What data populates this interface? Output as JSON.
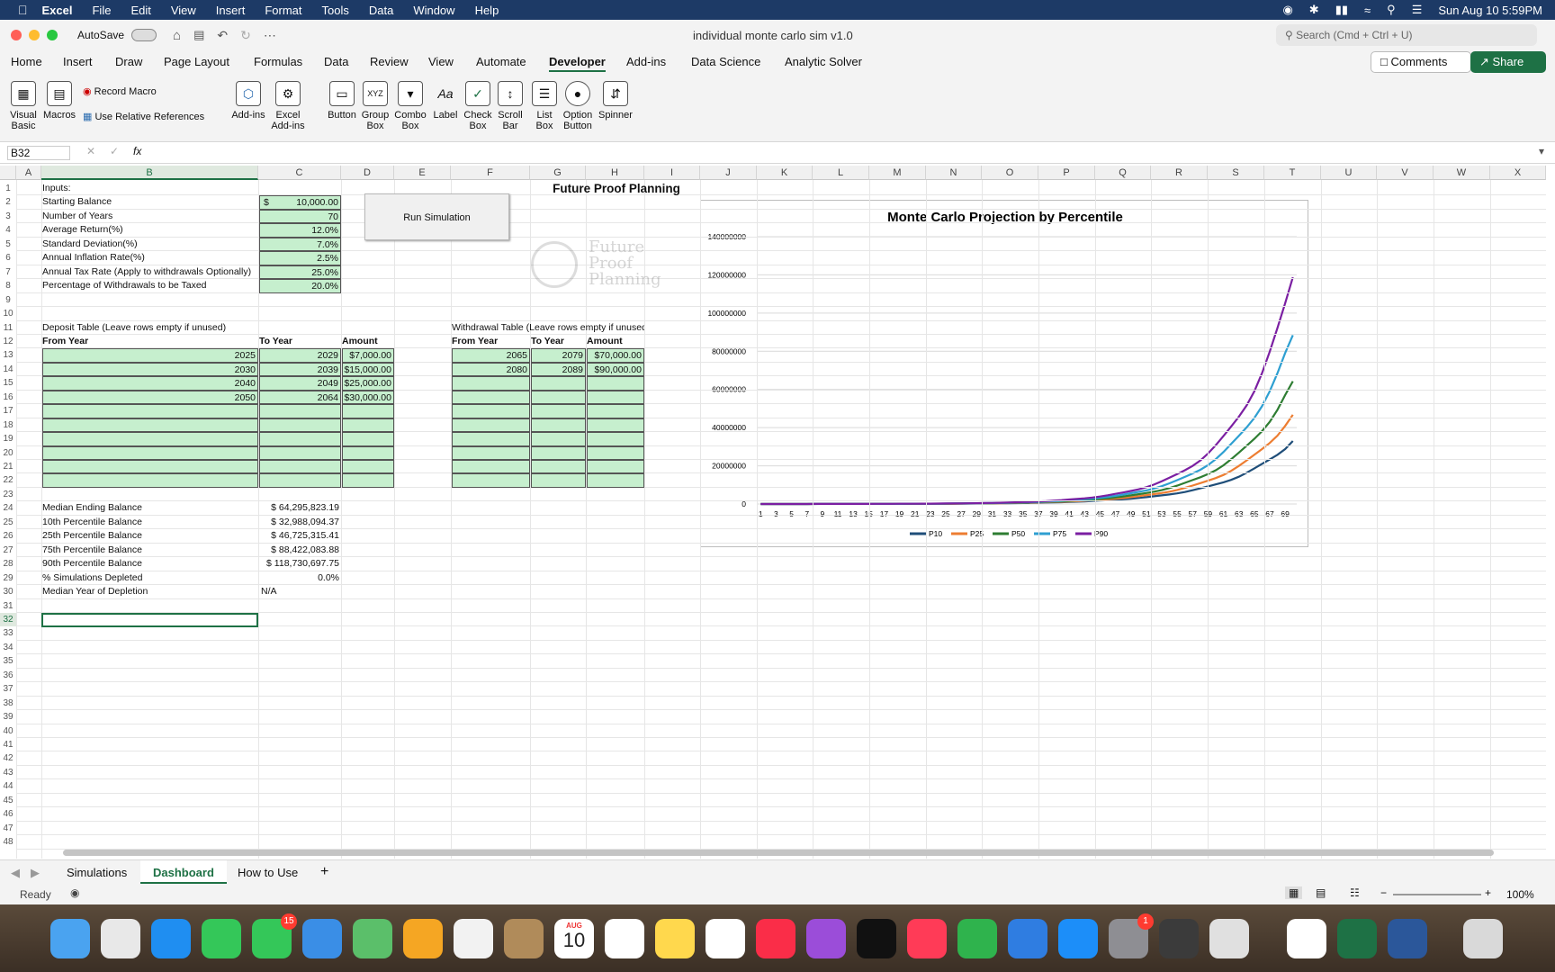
{
  "menubar": {
    "app": "Excel",
    "items": [
      "File",
      "Edit",
      "View",
      "Insert",
      "Format",
      "Tools",
      "Data",
      "Window",
      "Help"
    ],
    "datetime": "Sun Aug 10  5:59PM"
  },
  "titlebar": {
    "autosave": "AutoSave",
    "doc_title": "individual monte carlo sim v1.0",
    "search_placeholder": "Search (Cmd + Ctrl + U)"
  },
  "ribbon_tabs": [
    "Home",
    "Insert",
    "Draw",
    "Page Layout",
    "Formulas",
    "Data",
    "Review",
    "View",
    "Automate",
    "Developer",
    "Add-ins",
    "Data Science",
    "Analytic Solver"
  ],
  "active_tab": "Developer",
  "comments_label": "Comments",
  "share_label": "Share",
  "ribbon": {
    "visual_basic": "Visual Basic",
    "macros": "Macros",
    "record_macro": "Record Macro",
    "relative_refs": "Use Relative References",
    "addins": "Add-ins",
    "excel_addins": "Excel Add-ins",
    "button": "Button",
    "group_box": "Group Box",
    "combo_box": "Combo Box",
    "label": "Label",
    "check_box": "Check Box",
    "scroll_bar": "Scroll Bar",
    "list_box": "List Box",
    "option_button": "Option Button",
    "spinner": "Spinner"
  },
  "formula_bar": {
    "name_box": "B32",
    "fx": "fx",
    "value": ""
  },
  "columns": [
    "A",
    "B",
    "C",
    "D",
    "E",
    "F",
    "G",
    "H",
    "I",
    "J",
    "K",
    "L",
    "M",
    "N",
    "O",
    "P",
    "Q",
    "R",
    "S",
    "T",
    "U",
    "V",
    "W",
    "X"
  ],
  "sheet": {
    "inputs_label": "Inputs:",
    "inputs": [
      {
        "label": "Starting Balance",
        "value": "10,000.00",
        "prefix": "$"
      },
      {
        "label": "Number of Years",
        "value": "70",
        "prefix": ""
      },
      {
        "label": "Average Return(%)",
        "value": "12.0%",
        "prefix": ""
      },
      {
        "label": "Standard Deviation(%)",
        "value": "7.0%",
        "prefix": ""
      },
      {
        "label": "Annual Inflation Rate(%)",
        "value": "2.5%",
        "prefix": ""
      },
      {
        "label": "Annual Tax Rate (Apply to withdrawals Optionally)",
        "value": "25.0%",
        "prefix": ""
      },
      {
        "label": "Percentage of Withdrawals to be Taxed",
        "value": "20.0%",
        "prefix": ""
      }
    ],
    "run_button": "Run Simulation",
    "heading": "Future Proof Planning",
    "logo_text": [
      "Future",
      "Proof",
      "Planning"
    ],
    "deposit_title": "Deposit Table (Leave rows empty if unused)",
    "deposit_headers": [
      "From Year",
      "To Year",
      "Amount"
    ],
    "deposits": [
      [
        "2025",
        "2029",
        "$7,000.00"
      ],
      [
        "2030",
        "2039",
        "$15,000.00"
      ],
      [
        "2040",
        "2049",
        "$25,000.00"
      ],
      [
        "2050",
        "2064",
        "$30,000.00"
      ]
    ],
    "withdrawal_title": "Withdrawal Table (Leave rows empty if unused)",
    "withdrawal_headers": [
      "From Year",
      "To Year",
      "Amount"
    ],
    "withdrawals": [
      [
        "2065",
        "2079",
        "$70,000.00"
      ],
      [
        "2080",
        "2089",
        "$90,000.00"
      ]
    ],
    "results": [
      {
        "label": "Median Ending Balance",
        "value": "$   64,295,823.19"
      },
      {
        "label": "10th Percentile Balance",
        "value": "$   32,988,094.37"
      },
      {
        "label": "25th Percentile Balance",
        "value": "$   46,725,315.41"
      },
      {
        "label": "75th Percentile Balance",
        "value": "$   88,422,083.88"
      },
      {
        "label": "90th Percentile Balance",
        "value": "$ 118,730,697.75"
      },
      {
        "label": "% Simulations Depleted",
        "value": "0.0%"
      },
      {
        "label": "Median Year of Depletion",
        "value": "N/A"
      }
    ]
  },
  "chart_data": {
    "type": "line",
    "title": "Monte Carlo Projection by Percentile",
    "ylim": [
      0,
      140000000
    ],
    "yticks": [
      "0",
      "20000000",
      "40000000",
      "60000000",
      "80000000",
      "100000000",
      "120000000",
      "140000000"
    ],
    "xticks": [
      "1",
      "3",
      "5",
      "7",
      "9",
      "11",
      "13",
      "15",
      "17",
      "19",
      "21",
      "23",
      "25",
      "27",
      "29",
      "31",
      "33",
      "35",
      "37",
      "39",
      "41",
      "43",
      "45",
      "47",
      "49",
      "51",
      "53",
      "55",
      "57",
      "59",
      "61",
      "63",
      "65",
      "67",
      "69"
    ],
    "x_count": 70,
    "legend_position": "bottom",
    "series": [
      {
        "name": "P10",
        "color": "#1f4e79",
        "final": 32988094
      },
      {
        "name": "P25",
        "color": "#ed7d31",
        "final": 46725315
      },
      {
        "name": "P50",
        "color": "#2e7d32",
        "final": 64295823
      },
      {
        "name": "P75",
        "color": "#2e9fd1",
        "final": 88422083
      },
      {
        "name": "P90",
        "color": "#7b1fa2",
        "final": 118730697
      }
    ]
  },
  "sheet_tabs": [
    "Simulations",
    "Dashboard",
    "How to Use"
  ],
  "active_sheet": "Dashboard",
  "status": {
    "ready": "Ready",
    "zoom": "100%"
  },
  "dock_badges": {
    "messages": "15",
    "settings": "1"
  },
  "dock_calendar": {
    "month": "AUG",
    "day": "10"
  }
}
